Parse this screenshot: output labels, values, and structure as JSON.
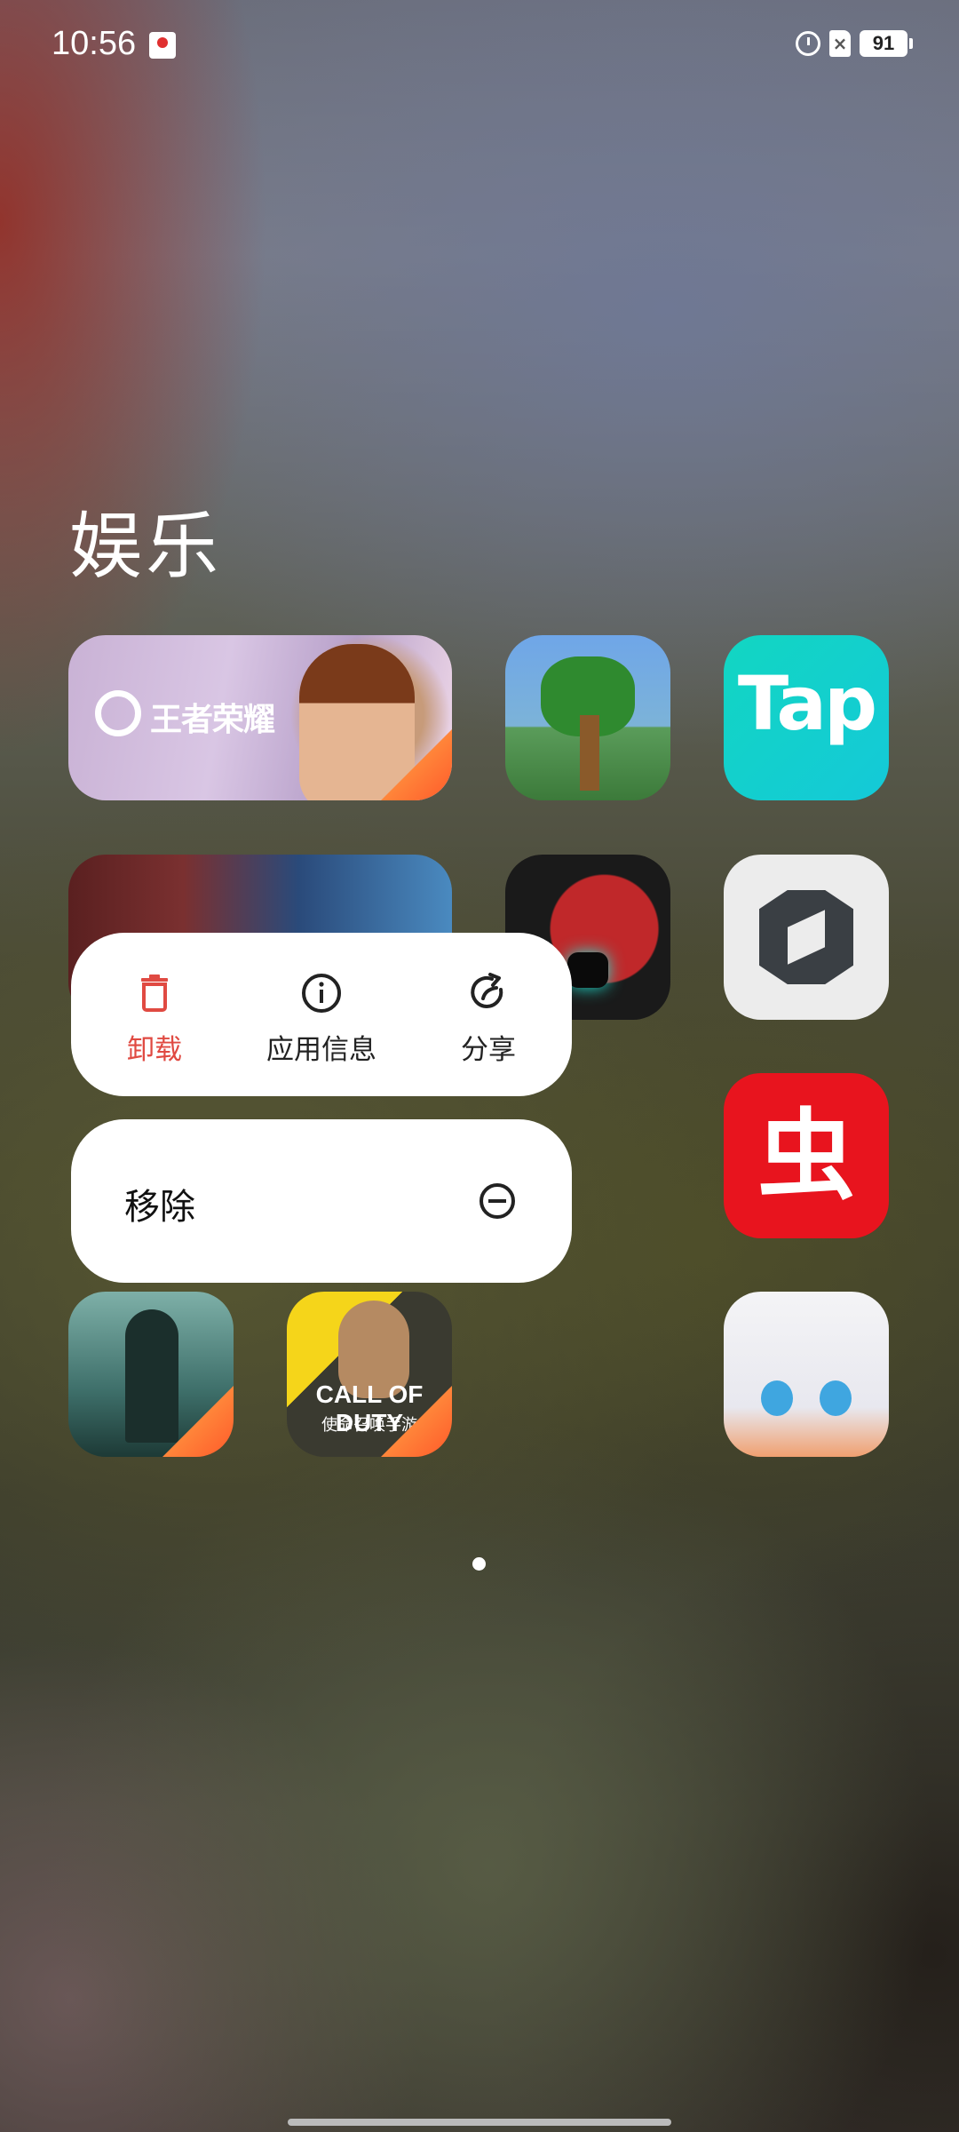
{
  "status_bar": {
    "time": "10:56",
    "battery": "91",
    "sim_indicator": "×"
  },
  "folder": {
    "title": "娱乐"
  },
  "apps": {
    "honor_of_kings_label": "王者荣耀",
    "tap_label": "Tap",
    "chong_label": "虫",
    "cod_label": "CALL OF DUTY",
    "cod_sub": "使命召唤手游"
  },
  "context_menu": {
    "uninstall": "卸载",
    "app_info": "应用信息",
    "share": "分享",
    "remove": "移除"
  },
  "colors": {
    "danger": "#e04a42",
    "menu_bg": "#ffffff"
  }
}
